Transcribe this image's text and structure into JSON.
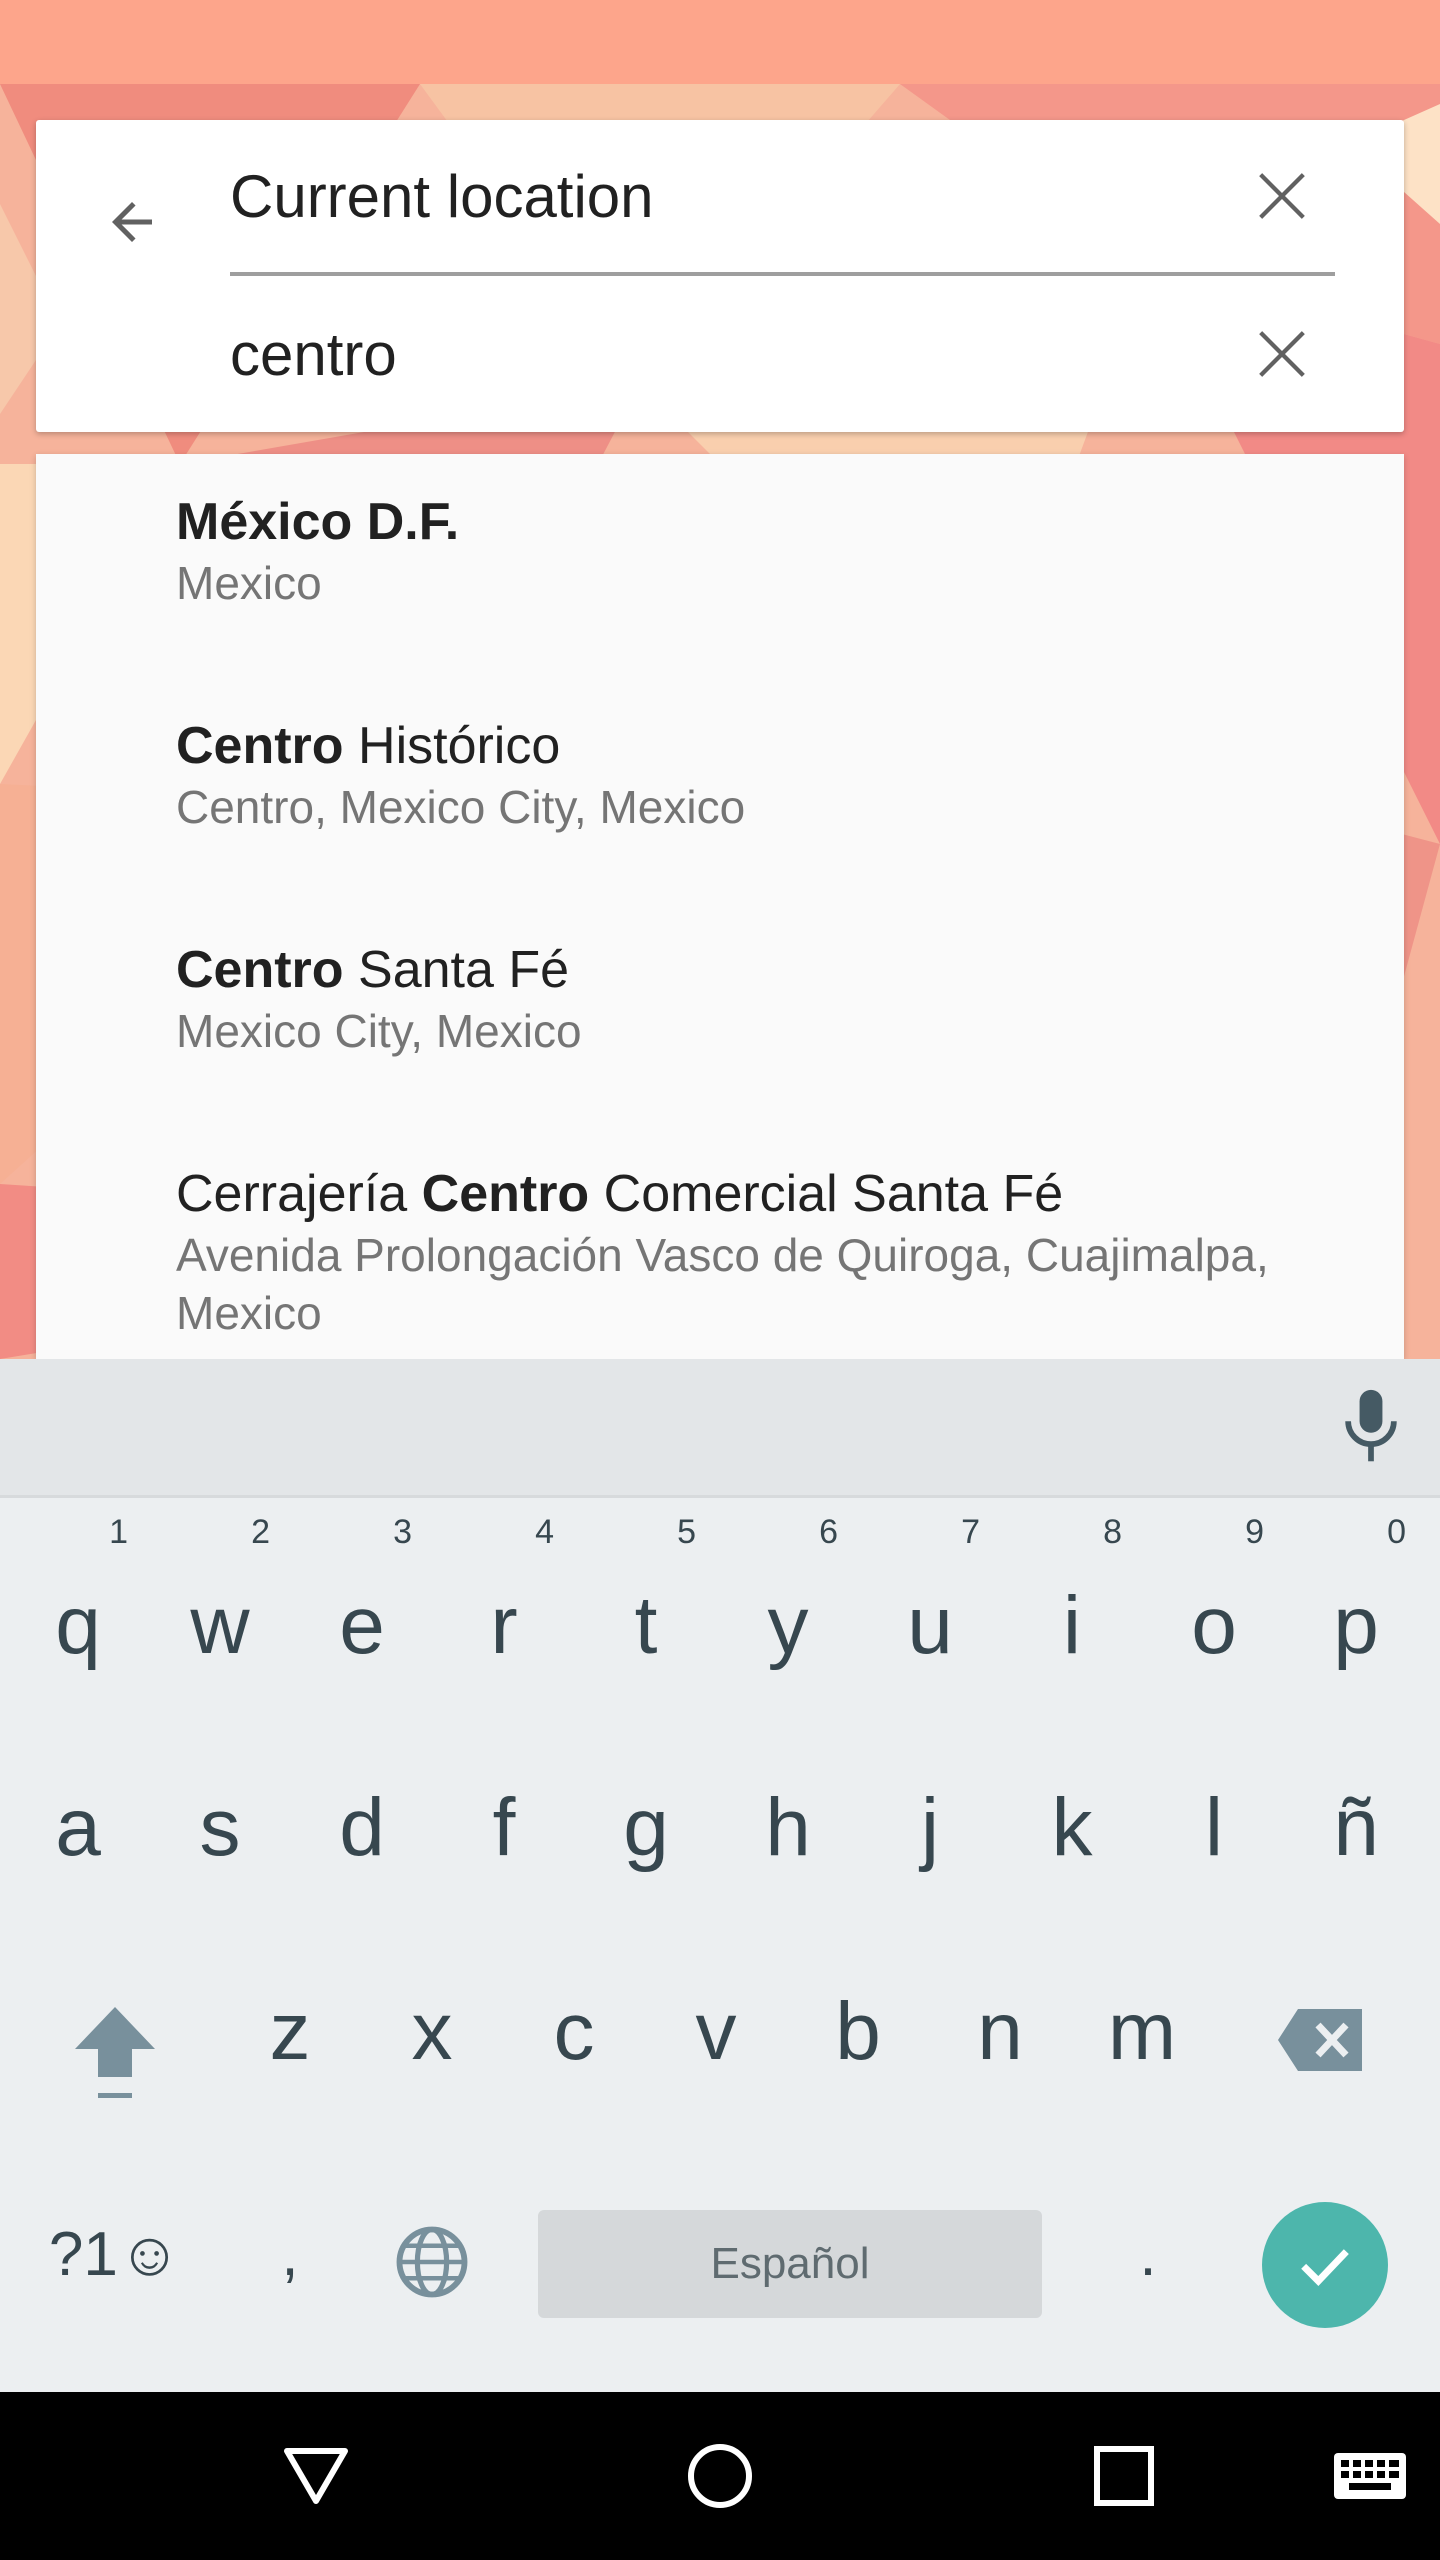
{
  "search": {
    "origin_value": "Current location",
    "destination_value": "centro"
  },
  "suggestions": [
    {
      "prefix": "",
      "bold": "México D.F.",
      "rest": "",
      "subtitle": "Mexico"
    },
    {
      "prefix": "",
      "bold": "Centro",
      "rest": " Histórico",
      "subtitle": "Centro, Mexico City, Mexico"
    },
    {
      "prefix": "",
      "bold": "Centro",
      "rest": " Santa Fé",
      "subtitle": "Mexico City, Mexico"
    },
    {
      "prefix": "Cerrajería ",
      "bold": "Centro",
      "rest": " Comercial Santa Fé",
      "subtitle": "Avenida Prolongación Vasco de Quiroga, Cuajimalpa, Mexico"
    }
  ],
  "keyboard": {
    "row1": [
      "q",
      "w",
      "e",
      "r",
      "t",
      "y",
      "u",
      "i",
      "o",
      "p"
    ],
    "row1_hints": [
      "1",
      "2",
      "3",
      "4",
      "5",
      "6",
      "7",
      "8",
      "9",
      "0"
    ],
    "row2": [
      "a",
      "s",
      "d",
      "f",
      "g",
      "h",
      "j",
      "k",
      "l",
      "ñ"
    ],
    "row3": [
      "z",
      "x",
      "c",
      "v",
      "b",
      "n",
      "m"
    ],
    "symbols_label": "?1☺",
    "comma": ",",
    "period": ".",
    "space_label": "Español"
  },
  "colors": {
    "accent": "#4db6ac",
    "status_bar": "#fda58b",
    "keyboard_bg": "#eceff1"
  },
  "icons": {
    "back": "arrow-left-icon",
    "clear": "close-icon",
    "mic": "microphone-icon",
    "shift": "shift-icon",
    "delete": "backspace-icon",
    "globe": "globe-icon",
    "enter": "check-icon",
    "nav_back": "triangle-back-icon",
    "nav_home": "circle-home-icon",
    "nav_recents": "square-recents-icon",
    "nav_keyboard": "keyboard-icon"
  }
}
